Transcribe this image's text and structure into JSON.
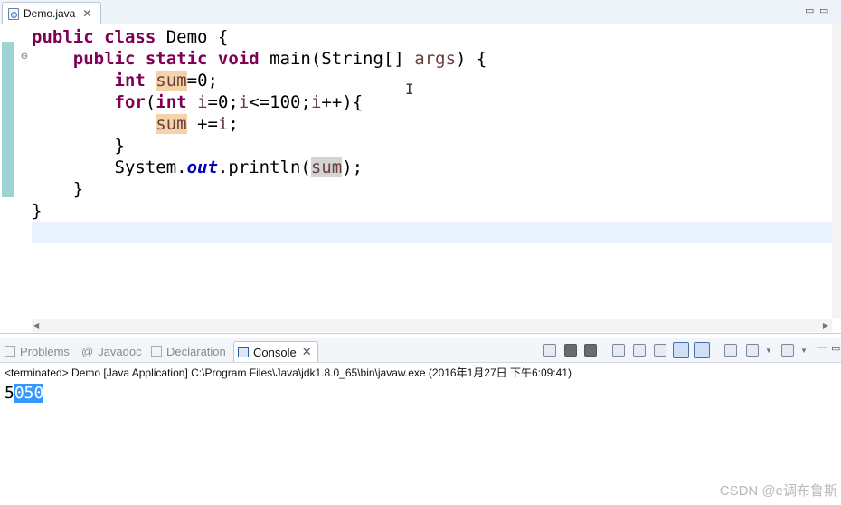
{
  "editor": {
    "tab_label": "Demo.java",
    "tab_close": "✕",
    "window_controls": [
      "▭",
      "▭"
    ],
    "fold_marker": "⊖",
    "code": {
      "l1": {
        "kw": "public class",
        "rest": " Demo {"
      },
      "l2": {
        "kw": "public static void",
        "mid": " main(String[] ",
        "arg": "args",
        "rest": ") {"
      },
      "l3": {
        "kw": "int",
        "var": "sum",
        "rest": "=0;"
      },
      "l4": {
        "kw1": "for",
        "p1": "(",
        "kw2": "int",
        "v1": " i",
        "p2": "=0;",
        "v2": "i",
        "p3": "<=100;",
        "v3": "i",
        "p4": "++){"
      },
      "l5": {
        "var": "sum",
        "mid": " +=",
        "v2": "i",
        "rest": ";"
      },
      "l6": "}",
      "l7": {
        "pre": "System.",
        "fld": "out",
        "mid": ".println(",
        "var": "sum",
        "rest": ");"
      },
      "l8": "}",
      "l9": "}"
    }
  },
  "console": {
    "tabs": {
      "problems": "Problems",
      "javadoc": "Javadoc",
      "declaration": "Declaration",
      "console": "Console",
      "close": "✕",
      "at": "@"
    },
    "status": "<terminated> Demo [Java Application] C:\\Program Files\\Java\\jdk1.8.0_65\\bin\\javaw.exe (2016年1月27日 下午6:09:41)",
    "output": {
      "plain": "5",
      "selected": "050"
    }
  },
  "watermark": "CSDN @e调布鲁斯"
}
